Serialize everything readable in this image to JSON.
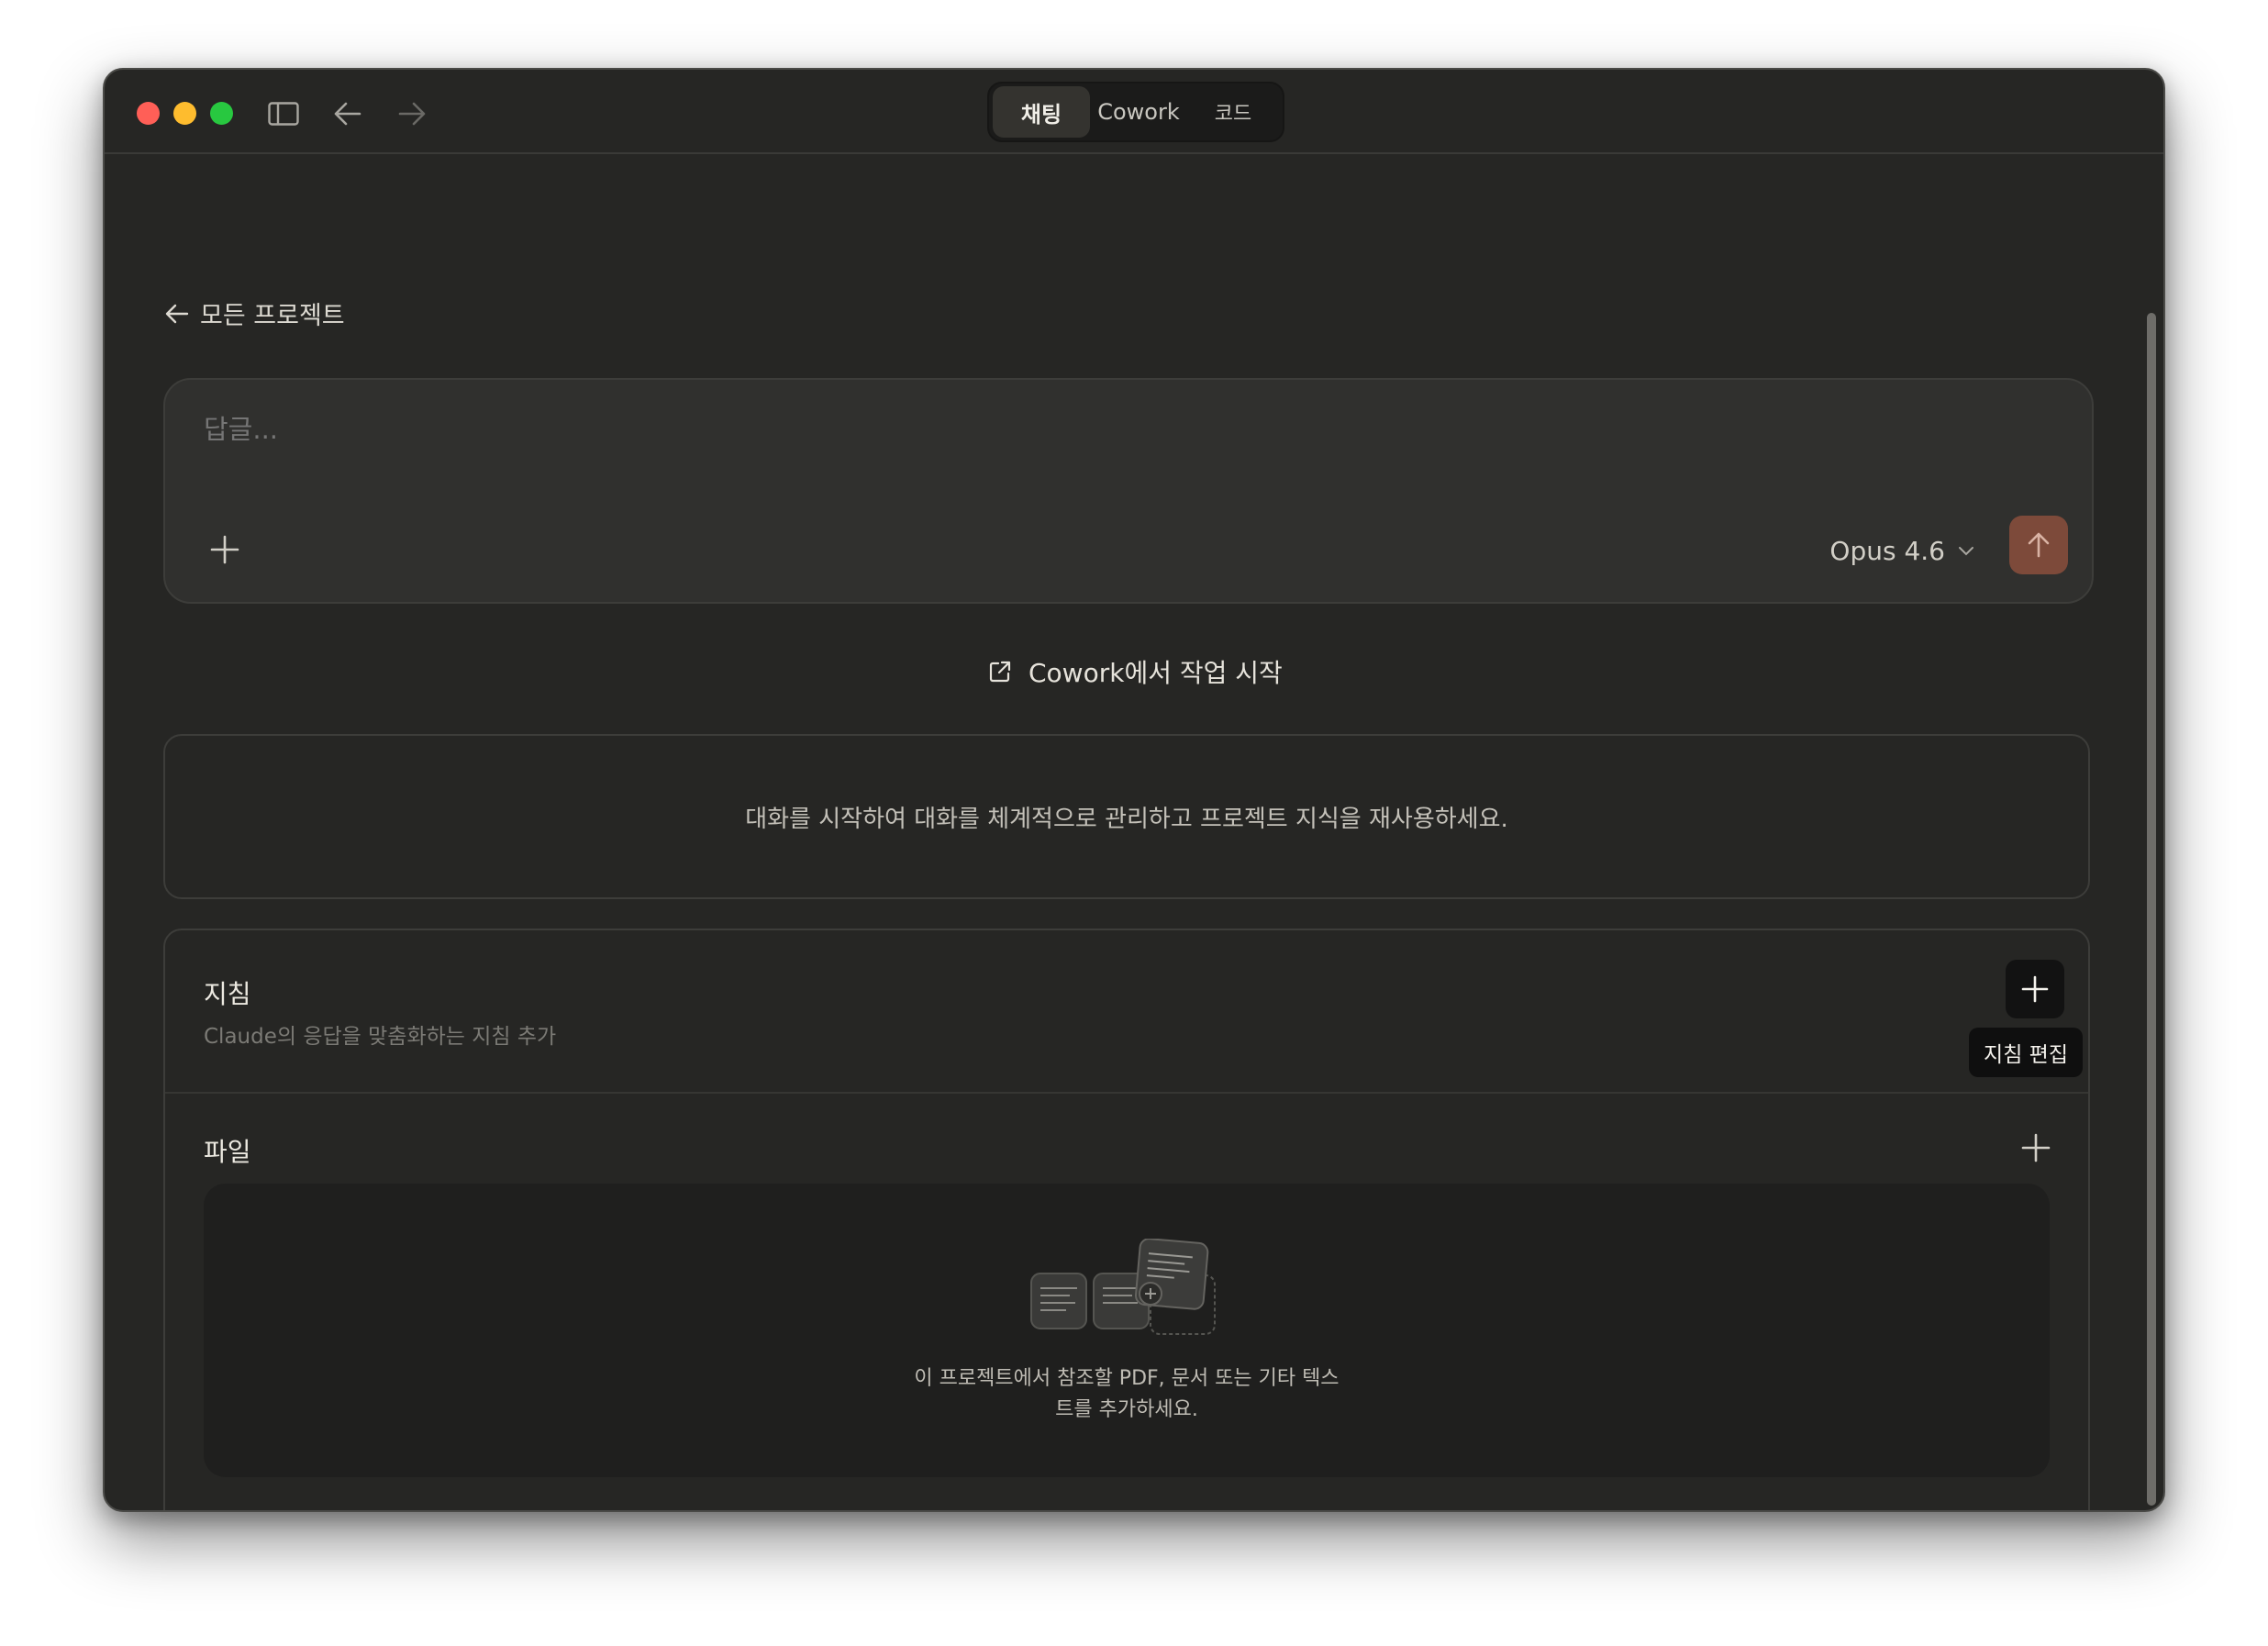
{
  "titlebar": {
    "tabs": [
      {
        "label": "채팅",
        "active": true
      },
      {
        "label": "Cowork",
        "active": false
      },
      {
        "label": "코드",
        "active": false
      }
    ]
  },
  "back_link": {
    "label": "모든 프로젝트"
  },
  "composer": {
    "placeholder": "답글...",
    "model": "Opus 4.6"
  },
  "cowork_link": {
    "label": "Cowork에서 작업 시작"
  },
  "info": {
    "text": "대화를 시작하여 대화를 체계적으로 관리하고 프로젝트 지식을 재사용하세요."
  },
  "instructions": {
    "title": "지침",
    "subtitle": "Claude의 응답을 맞춤화하는 지침 추가",
    "tooltip": "지침 편집"
  },
  "files": {
    "title": "파일",
    "empty_line1": "이 프로젝트에서 참조할 PDF, 문서 또는 기타 텍스",
    "empty_line2": "트를 추가하세요."
  },
  "colors": {
    "background": "#262624",
    "send_button": "#7d4a3a",
    "traffic_red": "#ff5f57",
    "traffic_yellow": "#febc2e",
    "traffic_green": "#28c840"
  },
  "icons": [
    "sidebar-toggle-icon",
    "arrow-left-icon",
    "arrow-right-icon",
    "plus-icon",
    "chevron-down-icon",
    "arrow-up-icon",
    "external-link-icon",
    "documents-icon"
  ]
}
